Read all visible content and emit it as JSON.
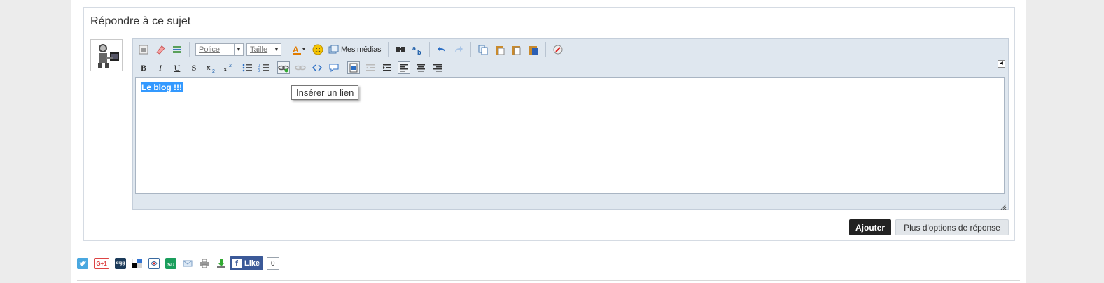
{
  "reply": {
    "title": "Répondre à ce sujet"
  },
  "toolbar": {
    "font_combo": "Police",
    "size_combo": "Taille",
    "medias_label": "Mes médias",
    "bold": "B",
    "italic": "I",
    "underline": "U",
    "strike": "S"
  },
  "editor": {
    "content": "Le blog  !!!",
    "tooltip": "Insérer un lien"
  },
  "actions": {
    "submit_label": "Ajouter",
    "more_options_label": "Plus d'options de réponse"
  },
  "share": {
    "gplus_label": "G+1",
    "digg_label": "digg",
    "like_label": "Like",
    "like_count": "0"
  },
  "colors": {
    "selection": "#3399ff",
    "facebook": "#3b5998",
    "twitter": "#4aa8e0",
    "submit_button": "#222222"
  }
}
